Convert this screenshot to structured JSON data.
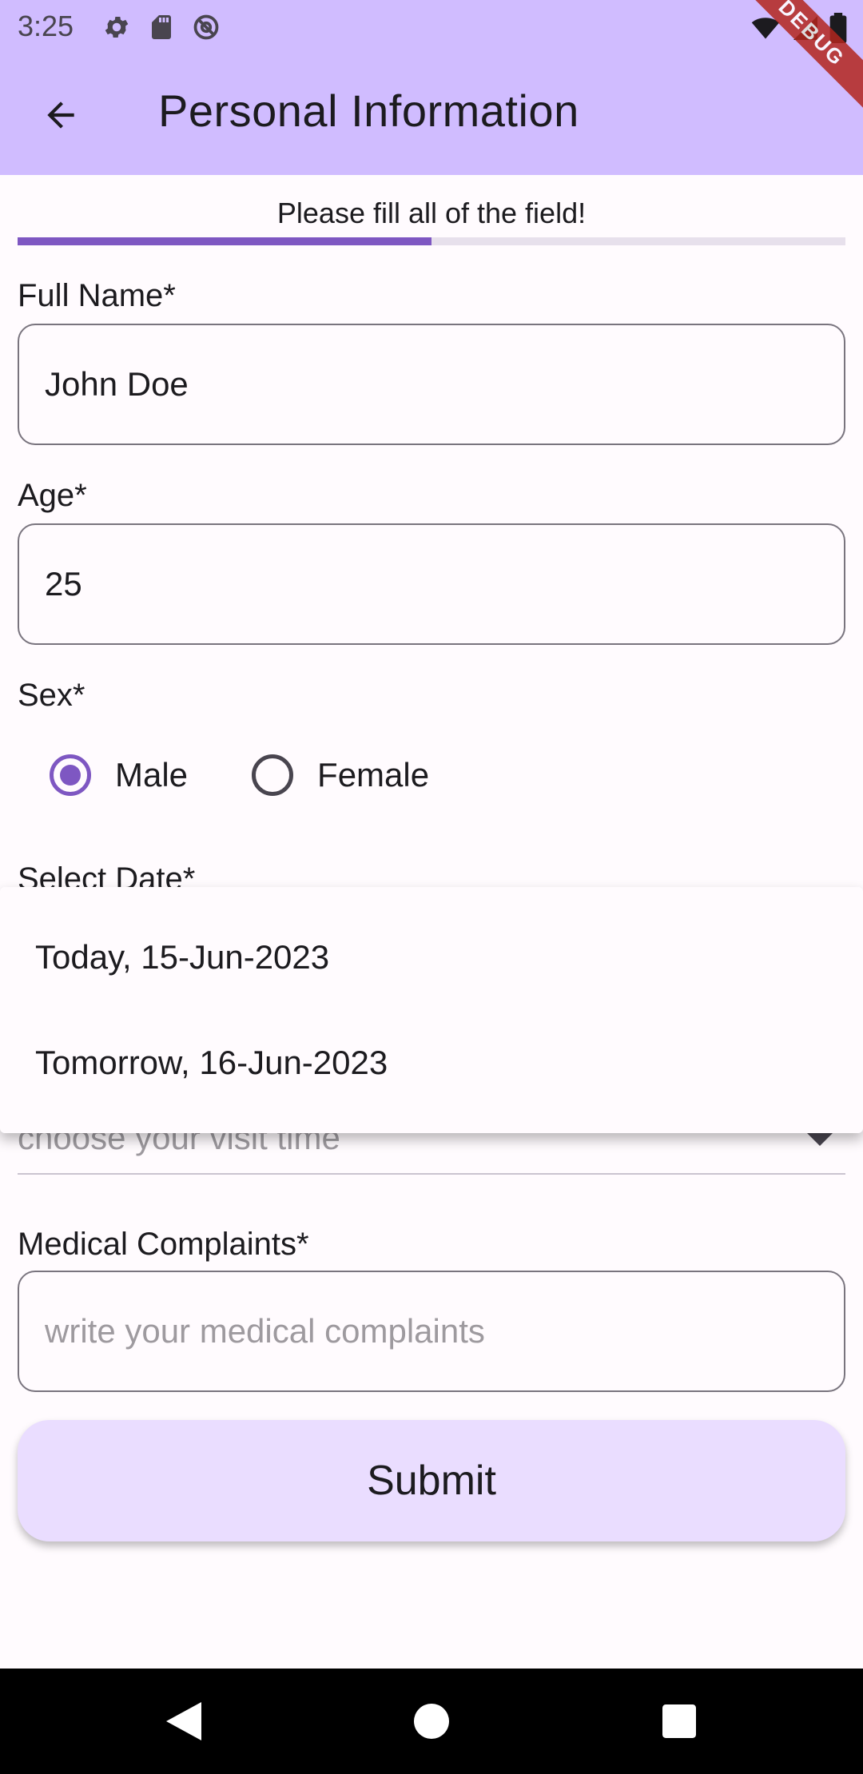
{
  "status_bar": {
    "time": "3:25",
    "icons_left": [
      "gear-icon",
      "sd-card-icon",
      "at-sign-icon"
    ],
    "icons_right": [
      "wifi-icon",
      "signal-icon",
      "battery-icon"
    ]
  },
  "app_bar": {
    "title": "Personal Information",
    "back_icon": "arrow-back-icon",
    "background": "#D0BCFF"
  },
  "debug_banner": "DEBUG",
  "progress": {
    "label": "Please fill all of the field!",
    "value": 0.5,
    "accent": "#7E57C2"
  },
  "form": {
    "full_name": {
      "label": "Full Name*",
      "value": "John Doe"
    },
    "age": {
      "label": "Age*",
      "value": "25"
    },
    "sex": {
      "label": "Sex*",
      "options": [
        {
          "label": "Male",
          "selected": true
        },
        {
          "label": "Female",
          "selected": false
        }
      ]
    },
    "date": {
      "label": "Select Date*"
    },
    "visit_time": {
      "placeholder": "choose your visit time"
    },
    "medical_complaints": {
      "label": "Medical Complaints*",
      "placeholder": "write your medical complaints",
      "value": ""
    },
    "submit_label": "Submit"
  },
  "date_menu": {
    "items": [
      {
        "label": "Today, 15-Jun-2023"
      },
      {
        "label": "Tomorrow, 16-Jun-2023"
      }
    ]
  },
  "nav_bar": {
    "items": [
      "back-triangle-icon",
      "home-circle-icon",
      "recents-square-icon"
    ]
  }
}
